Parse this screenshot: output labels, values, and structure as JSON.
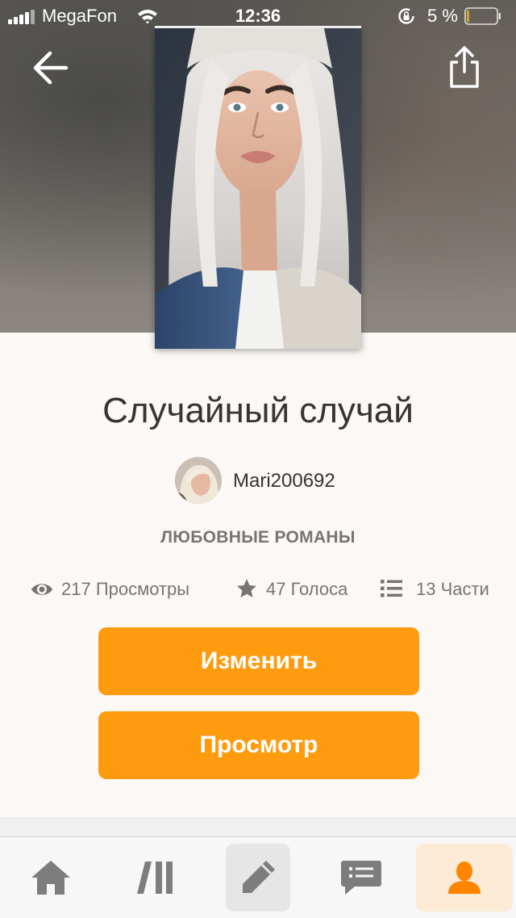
{
  "status_bar": {
    "carrier": "MegaFon",
    "time": "12:36",
    "battery_percent": "5 %",
    "battery_level": 0.05
  },
  "story": {
    "title": "Случайный случай",
    "author": "Mari200692",
    "genre": "ЛЮБОВНЫЕ РОМАНЫ"
  },
  "stats": {
    "views": "217 Просмотры",
    "votes": "47 Голоса",
    "parts": "13 Части"
  },
  "actions": {
    "edit_label": "Изменить",
    "view_label": "Просмотр"
  },
  "tab_bar": {
    "items": [
      {
        "icon": "home-icon"
      },
      {
        "icon": "library-icon"
      },
      {
        "icon": "pencil-icon"
      },
      {
        "icon": "chat-icon"
      },
      {
        "icon": "profile-icon"
      }
    ]
  },
  "colors": {
    "accent": "#ff9b0f",
    "profile_tab_bg": "#fdebd6",
    "text_dark": "#3a3430",
    "text_muted": "#7a7470"
  }
}
